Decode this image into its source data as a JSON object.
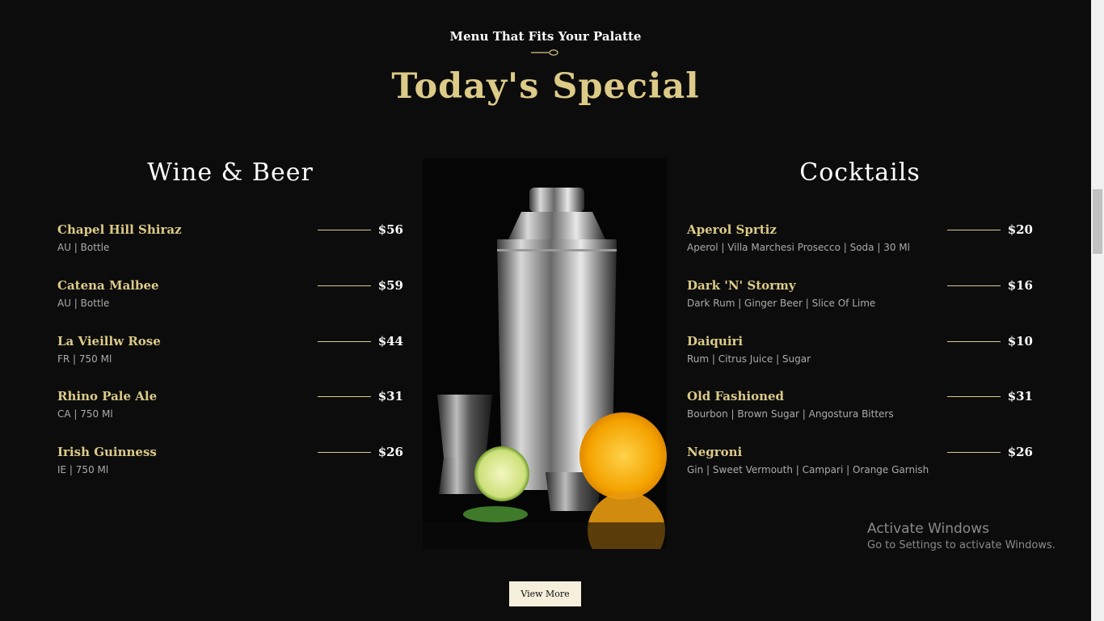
{
  "header": {
    "subtitle": "Menu That Fits Your Palatte",
    "title": "Today's Special"
  },
  "wine_beer": {
    "heading": "Wine & Beer",
    "items": [
      {
        "name": "Chapel Hill Shiraz",
        "price": "$56",
        "desc": "AU | Bottle"
      },
      {
        "name": "Catena Malbee",
        "price": "$59",
        "desc": "AU | Bottle"
      },
      {
        "name": "La Vieillw Rose",
        "price": "$44",
        "desc": "FR | 750 Ml"
      },
      {
        "name": "Rhino Pale Ale",
        "price": "$31",
        "desc": "CA | 750 Ml"
      },
      {
        "name": "Irish Guinness",
        "price": "$26",
        "desc": "IE | 750 Ml"
      }
    ]
  },
  "cocktails": {
    "heading": "Cocktails",
    "items": [
      {
        "name": "Aperol Sprtiz",
        "price": "$20",
        "desc": "Aperol | Villa Marchesi Prosecco | Soda | 30 Ml"
      },
      {
        "name": "Dark 'N' Stormy",
        "price": "$16",
        "desc": "Dark Rum | Ginger Beer | Slice Of Lime"
      },
      {
        "name": "Daiquiri",
        "price": "$10",
        "desc": "Rum | Citrus Juice | Sugar"
      },
      {
        "name": "Old Fashioned",
        "price": "$31",
        "desc": "Bourbon | Brown Sugar | Angostura Bitters"
      },
      {
        "name": "Negroni",
        "price": "$26",
        "desc": "Gin | Sweet Vermouth | Campari | Orange Garnish"
      }
    ]
  },
  "view_more_label": "View More",
  "watermark": {
    "title": "Activate Windows",
    "subtitle": "Go to Settings to activate Windows."
  },
  "colors": {
    "background": "#0c0c0c",
    "gold": "#dcca87",
    "button_bg": "#f5efdb"
  }
}
